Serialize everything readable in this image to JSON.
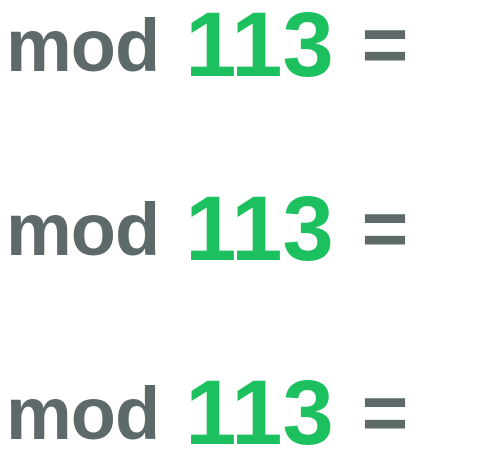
{
  "rows": [
    {
      "word": "mod",
      "number": "113",
      "symbol": "="
    },
    {
      "word": "mod",
      "number": "113",
      "symbol": "="
    },
    {
      "word": "mod",
      "number": "113",
      "symbol": "="
    }
  ],
  "colors": {
    "word": "#5e6a6a",
    "number": "#1cc05e",
    "background": "#ffffff"
  }
}
